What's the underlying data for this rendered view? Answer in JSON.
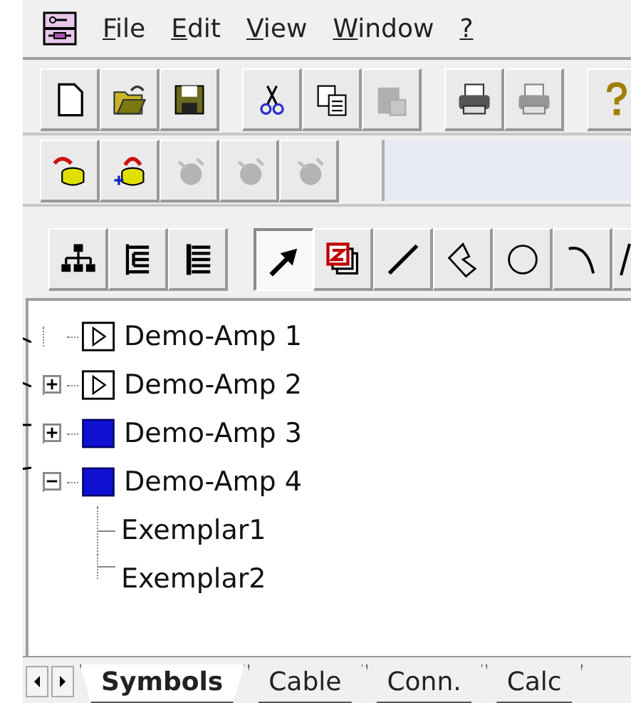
{
  "menu": [
    {
      "label": "File"
    },
    {
      "label": "Edit"
    },
    {
      "label": "View"
    },
    {
      "label": "Window"
    },
    {
      "label": "?"
    }
  ],
  "toolbars": [
    {
      "groups": [
        [
          {
            "kind": "new",
            "disabled": false
          },
          {
            "kind": "open",
            "disabled": false
          },
          {
            "kind": "save",
            "disabled": false
          }
        ],
        [
          {
            "kind": "cut",
            "disabled": false
          },
          {
            "kind": "copy",
            "disabled": false
          },
          {
            "kind": "paste",
            "disabled": true
          }
        ],
        [
          {
            "kind": "print",
            "disabled": false
          },
          {
            "kind": "print",
            "disabled": true
          }
        ],
        [
          {
            "kind": "help",
            "disabled": false
          }
        ]
      ]
    },
    {
      "groups": [
        [
          {
            "kind": "pot-out",
            "disabled": false
          },
          {
            "kind": "pot-add",
            "disabled": false
          },
          {
            "kind": "pot",
            "disabled": true
          },
          {
            "kind": "pot",
            "disabled": true
          },
          {
            "kind": "pot",
            "disabled": true
          }
        ]
      ]
    },
    {
      "groups": [
        [
          {
            "kind": "hierarchy",
            "disabled": false,
            "selected": false
          },
          {
            "kind": "list-tree",
            "disabled": false,
            "selected": false
          },
          {
            "kind": "list",
            "disabled": false,
            "selected": false
          }
        ],
        [
          {
            "kind": "arrow",
            "disabled": false,
            "selected": true
          },
          {
            "kind": "layers",
            "disabled": false,
            "selected": false
          },
          {
            "kind": "line",
            "disabled": false,
            "selected": false
          },
          {
            "kind": "polygon",
            "disabled": false,
            "selected": false
          },
          {
            "kind": "circle",
            "disabled": false,
            "selected": false
          },
          {
            "kind": "arc",
            "disabled": false,
            "selected": false
          },
          {
            "kind": "text",
            "disabled": false,
            "selected": false
          }
        ]
      ]
    }
  ],
  "tree": [
    {
      "label": "Demo-Amp 1",
      "kind": "outline"
    },
    {
      "label": "Demo-Amp 2",
      "kind": "outline",
      "expanded": false
    },
    {
      "label": "Demo-Amp 3",
      "kind": "filled",
      "expanded": false
    },
    {
      "label": "Demo-Amp 4",
      "kind": "filled",
      "expanded": true,
      "children": [
        {
          "label": "Exemplar1"
        },
        {
          "label": "Exemplar2"
        }
      ]
    }
  ],
  "tabs": [
    {
      "label": "Symbols",
      "selected": true
    },
    {
      "label": "Cable",
      "selected": false
    },
    {
      "label": "Conn.",
      "selected": false
    },
    {
      "label": "Calc",
      "selected": false
    }
  ]
}
